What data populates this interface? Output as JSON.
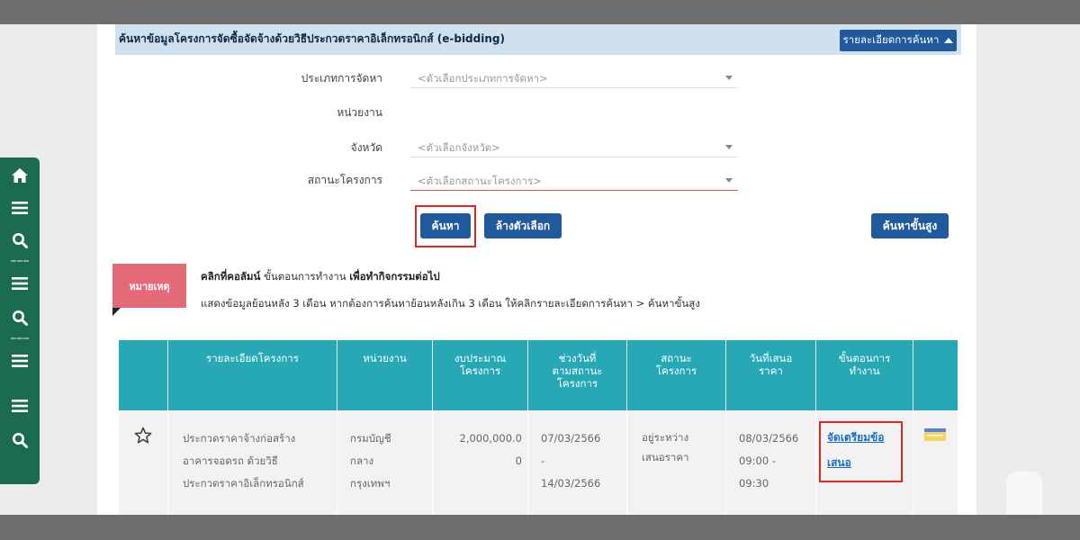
{
  "header": {
    "title": "ค้นหาข้อมูลโครงการจัดซื้อจัดจ้างด้วยวิธีประกวดราคาอิเล็กทรอนิกส์ (e-bidding)",
    "details_button": "รายละเอียดการค้นหา"
  },
  "form": {
    "procurement_type_label": "ประเภทการจัดหา",
    "procurement_type_placeholder": "<ตัวเลือกประเภทการจัดหา>",
    "agency_label": "หน่วยงาน",
    "province_label": "จังหวัด",
    "province_placeholder": "<ตัวเลือกจังหวัด>",
    "status_label": "สถานะโครงการ",
    "status_placeholder": "<ตัวเลือกสถานะโครงการ>"
  },
  "buttons": {
    "search": "ค้นหา",
    "clear": "ล้างตัวเลือก",
    "advanced": "ค้นหาขั้นสูง"
  },
  "note": {
    "tag": "หมายเหตุ",
    "line1_bold_a": "คลิกที่คอลัมน์",
    "line1_normal": " ขั้นตอนการทำงาน ",
    "line1_bold_b": "เพื่อทำกิจกรรมต่อไป",
    "line2": "แสดงข้อมูลย้อนหลัง 3 เดือน หากต้องการค้นหาย้อนหลังเกิน 3 เดือน ให้คลิกรายละเอียดการค้นหา > ค้นหาขั้นสูง"
  },
  "table": {
    "headers": {
      "details": "รายละเอียดโครงการ",
      "agency": "หน่วยงาน",
      "budget_1": "งบประมาณ",
      "budget_2": "โครงการ",
      "date_1": "ช่วงวันที่",
      "date_2": "ตามสถานะ",
      "date_3": "โครงการ",
      "status_1": "สถานะ",
      "status_2": "โครงการ",
      "offer_1": "วันที่เสนอ",
      "offer_2": "ราคา",
      "step_1": "ขั้นตอนการ",
      "step_2": "ทำงาน"
    },
    "row": {
      "details": [
        "ประกวดราคาจ้างก่อสร้าง",
        "อาคารจอดรถ ด้วยวิธี",
        "ประกวดราคาอิเล็กทรอนิกส์"
      ],
      "agency": [
        "กรมบัญชี",
        "กลาง",
        "กรุงเทพฯ"
      ],
      "budget": [
        "2,000,000.0",
        "0"
      ],
      "dates": [
        "07/03/2566",
        "-",
        "14/03/2566"
      ],
      "status": [
        "อยู่ระหว่าง",
        "เสนอราคา"
      ],
      "offer": [
        "08/03/2566",
        "09:00 -",
        "09:30"
      ],
      "step_link": [
        "จัดเตรียมข้อ",
        "เสนอ"
      ]
    }
  },
  "icons": {
    "sidebar": [
      "home-icon",
      "menu-icon",
      "search-icon",
      "menu-icon",
      "search-icon",
      "menu-icon",
      "menu-icon",
      "search-icon"
    ],
    "favorite": "star-outline-icon",
    "row_action": "document-icon"
  },
  "colors": {
    "sidebar": "#1b6a52",
    "header_bar": "#cfe1ee",
    "primary_button": "#1f5a9c",
    "table_header": "#26a8b5",
    "note_tag": "#e46a77",
    "highlight_box": "#e0271f",
    "link": "#1a6fc4"
  }
}
